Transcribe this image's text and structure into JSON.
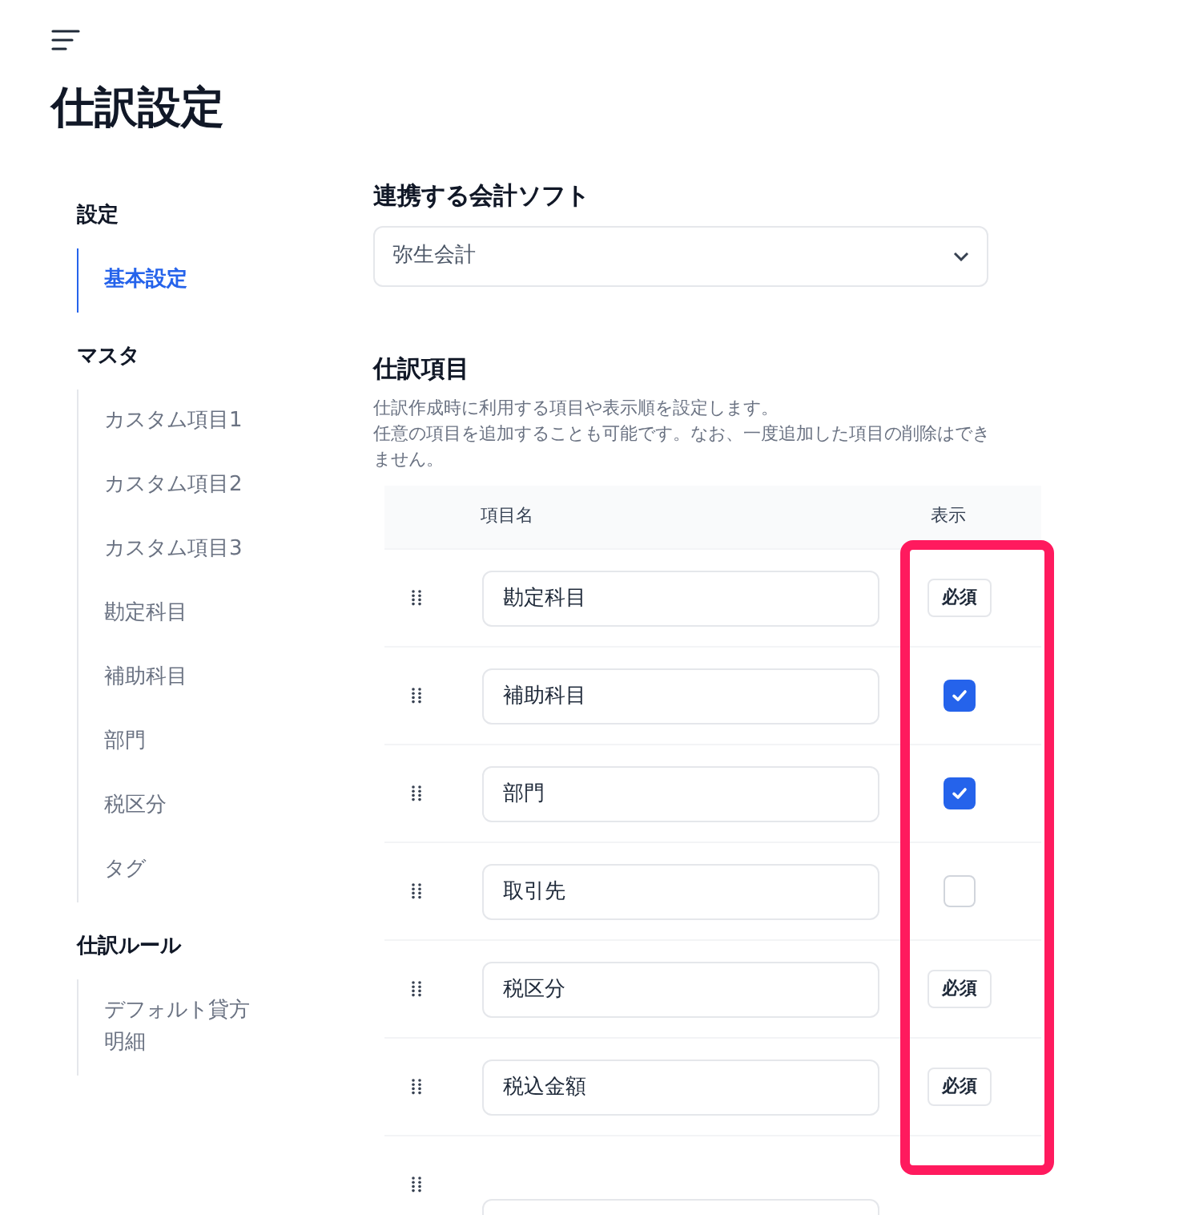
{
  "page_title": "仕訳設定",
  "sidebar": {
    "groups": [
      {
        "heading": "設定",
        "items": [
          {
            "label": "基本設定",
            "selected": true
          }
        ]
      },
      {
        "heading": "マスタ",
        "items": [
          {
            "label": "カスタム項目1",
            "selected": false
          },
          {
            "label": "カスタム項目2",
            "selected": false
          },
          {
            "label": "カスタム項目3",
            "selected": false
          },
          {
            "label": "勘定科目",
            "selected": false
          },
          {
            "label": "補助科目",
            "selected": false
          },
          {
            "label": "部門",
            "selected": false
          },
          {
            "label": "税区分",
            "selected": false
          },
          {
            "label": "タグ",
            "selected": false
          }
        ]
      },
      {
        "heading": "仕訳ルール",
        "items": [
          {
            "label": "デフォルト貸方明細",
            "selected": false
          }
        ]
      }
    ]
  },
  "software": {
    "heading": "連携する会計ソフト",
    "value": "弥生会計"
  },
  "journal_items": {
    "heading": "仕訳項目",
    "description": [
      "仕訳作成時に利用する項目や表示順を設定します。",
      "任意の項目を追加することも可能です。なお、一度追加した項目の削除はできません。"
    ],
    "columns": [
      "項目名",
      "表示"
    ],
    "rows": [
      {
        "name": "勘定科目",
        "kind": "required",
        "badge": "必須"
      },
      {
        "name": "補助科目",
        "kind": "checkbox",
        "checked": true
      },
      {
        "name": "部門",
        "kind": "checkbox",
        "checked": true
      },
      {
        "name": "取引先",
        "kind": "checkbox",
        "checked": false
      },
      {
        "name": "税区分",
        "kind": "required",
        "badge": "必須"
      },
      {
        "name": "税込金額",
        "kind": "required",
        "badge": "必須"
      },
      {
        "kind": "partial"
      }
    ]
  }
}
